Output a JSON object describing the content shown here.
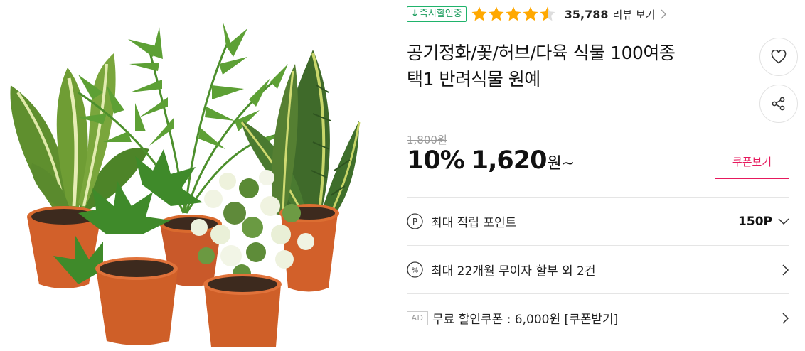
{
  "product": {
    "image_alt": "potted plants",
    "badge": {
      "arrow": "↓",
      "label": "즉시할인중"
    },
    "rating": 4.5,
    "review_count": "35,788",
    "review_link": "리뷰 보기",
    "title_line1": "공기정화/꽃/허브/다육 식물 100여종",
    "title_line2": "택1 반려식물 원예"
  },
  "price": {
    "original": "1,800원",
    "discount": "10%",
    "amount": "1,620",
    "unit": "원~",
    "coupon_button": "쿠폰보기"
  },
  "benefits": [
    {
      "icon": "point-icon",
      "label": "최대 적립 포인트",
      "value": "150P"
    },
    {
      "icon": "percent-icon",
      "label": "최대 22개월 무이자 할부 외 2건"
    },
    {
      "badge": "AD",
      "label": "무료 할인쿠폰 : 6,000원 [쿠폰받기]"
    }
  ],
  "colors": {
    "accent": "#e6195d",
    "badge_green": "#1a9c5c",
    "star": "#ffa800"
  }
}
